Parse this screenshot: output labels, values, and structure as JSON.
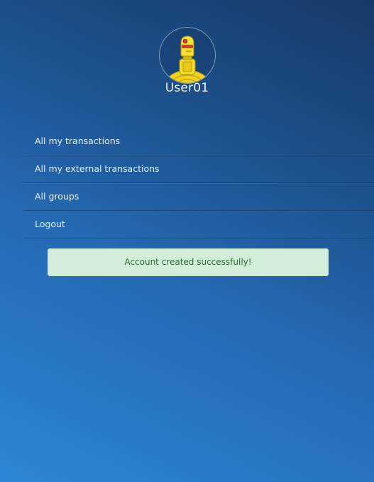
{
  "profile": {
    "username": "User01",
    "avatar_icon": "robot-avatar-icon"
  },
  "menu": {
    "items": [
      {
        "label": "All my transactions"
      },
      {
        "label": "All my external transactions"
      },
      {
        "label": "All groups"
      },
      {
        "label": "Logout"
      }
    ]
  },
  "alert": {
    "message": "Account created successfully!",
    "background_color": "#d4ecda",
    "text_color": "#2c6a37"
  },
  "colors": {
    "background_top": "#173a67",
    "background_bottom": "#2d86d6"
  }
}
